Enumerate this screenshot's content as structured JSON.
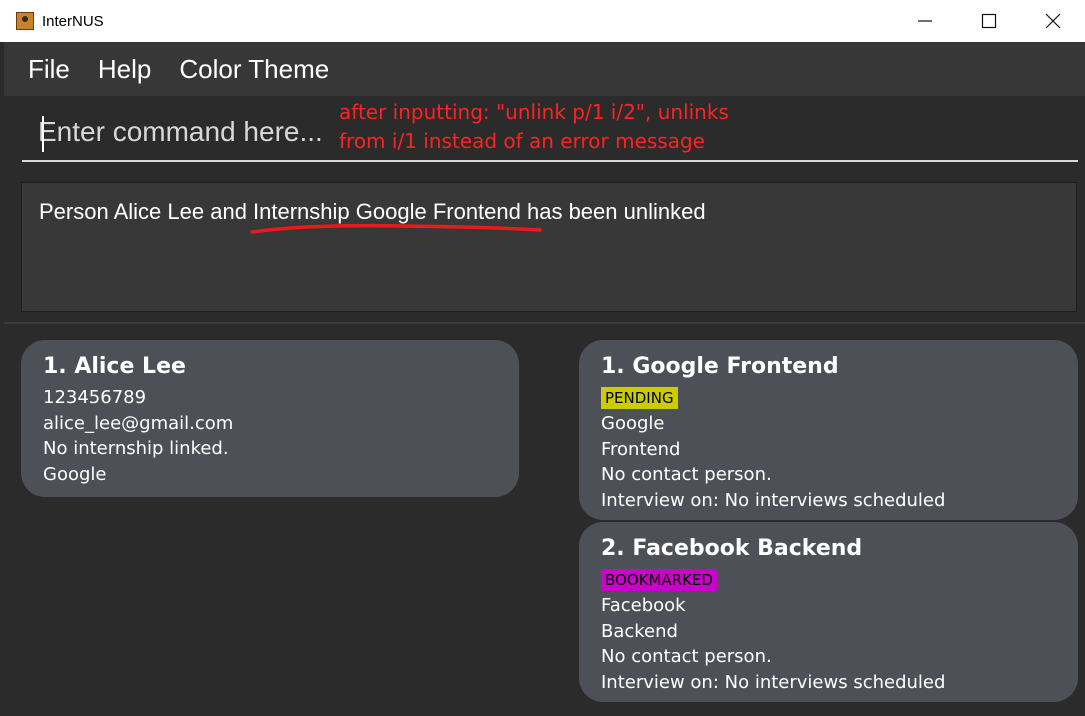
{
  "window": {
    "title": "InterNUS",
    "controls": {
      "minimize": "—",
      "maximize": "☐",
      "close": "✕"
    }
  },
  "menu": {
    "items": [
      "File",
      "Help",
      "Color Theme"
    ]
  },
  "command": {
    "placeholder": "Enter command here...",
    "value": ""
  },
  "annotation": {
    "line1": "after inputting: \"unlink p/1 i/2\", unlinks",
    "line2": "from i/1 instead of an error message",
    "color": "#ff2222"
  },
  "result": {
    "text": "Person Alice Lee and Internship Google Frontend has been unlinked"
  },
  "persons": [
    {
      "title": "1.  Alice Lee",
      "phone": "123456789",
      "email": "alice_lee@gmail.com",
      "internship": "No internship linked.",
      "company": "Google"
    }
  ],
  "internships": [
    {
      "title": "1.  Google Frontend",
      "status": "PENDING",
      "status_color": "#cccc00",
      "company": "Google",
      "role": "Frontend",
      "contact": "No contact person.",
      "interview": "Interview on: No interviews scheduled"
    },
    {
      "title": "2.  Facebook Backend",
      "status": "BOOKMARKED",
      "status_color": "#cc00cc",
      "company": "Facebook",
      "role": "Backend",
      "contact": "No contact person.",
      "interview": "Interview on: No interviews scheduled"
    }
  ]
}
